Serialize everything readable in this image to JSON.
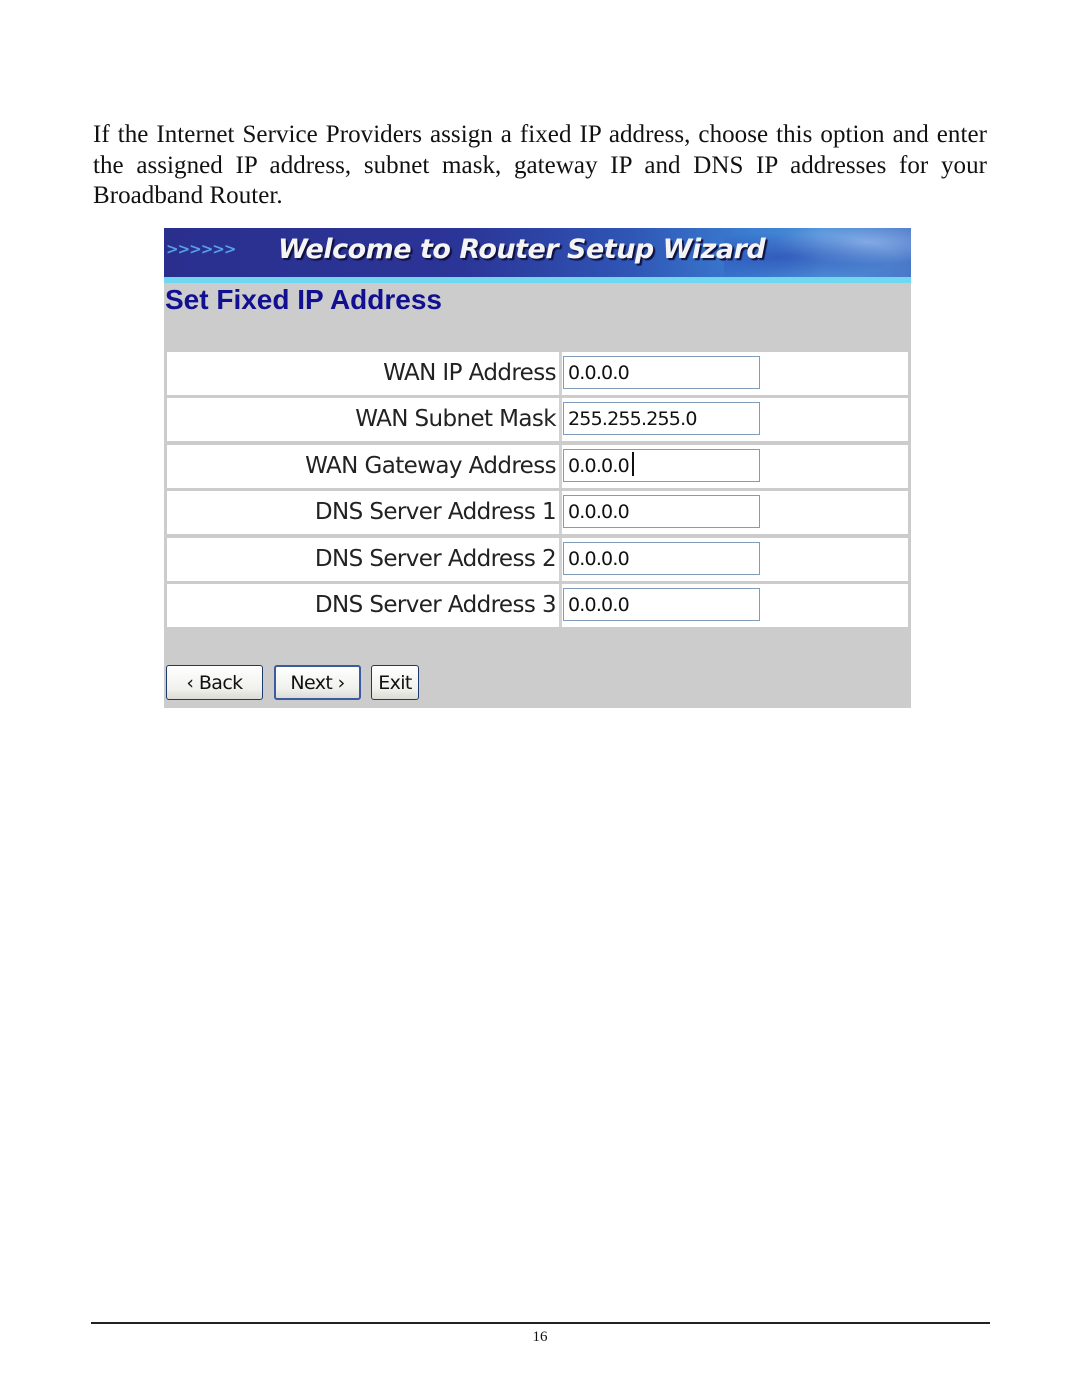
{
  "document": {
    "intro_text": "If the Internet Service Providers assign a fixed IP address, choose this option and enter the assigned IP address, subnet mask, gateway IP and DNS IP addresses for your Broadband Router.",
    "page_number": "16"
  },
  "wizard": {
    "banner_arrows": ">>>>>>",
    "banner_title": "Welcome to Router Setup Wizard",
    "heading": "Set Fixed IP Address",
    "fields": [
      {
        "label": "WAN IP Address",
        "value": "0.0.0.0"
      },
      {
        "label": "WAN Subnet Mask",
        "value": "255.255.255.0"
      },
      {
        "label": "WAN Gateway Address",
        "value": "0.0.0.0"
      },
      {
        "label": "DNS Server Address 1",
        "value": "0.0.0.0"
      },
      {
        "label": "DNS Server Address 2",
        "value": "0.0.0.0"
      },
      {
        "label": "DNS Server Address 3",
        "value": "0.0.0.0"
      }
    ],
    "buttons": {
      "back": "‹ Back",
      "next": "Next ›",
      "exit": "Exit"
    },
    "colors": {
      "banner": "#2b3597",
      "heading": "#101090",
      "panel": "#cccccc",
      "accent_strip": "#6fd8f0"
    }
  }
}
